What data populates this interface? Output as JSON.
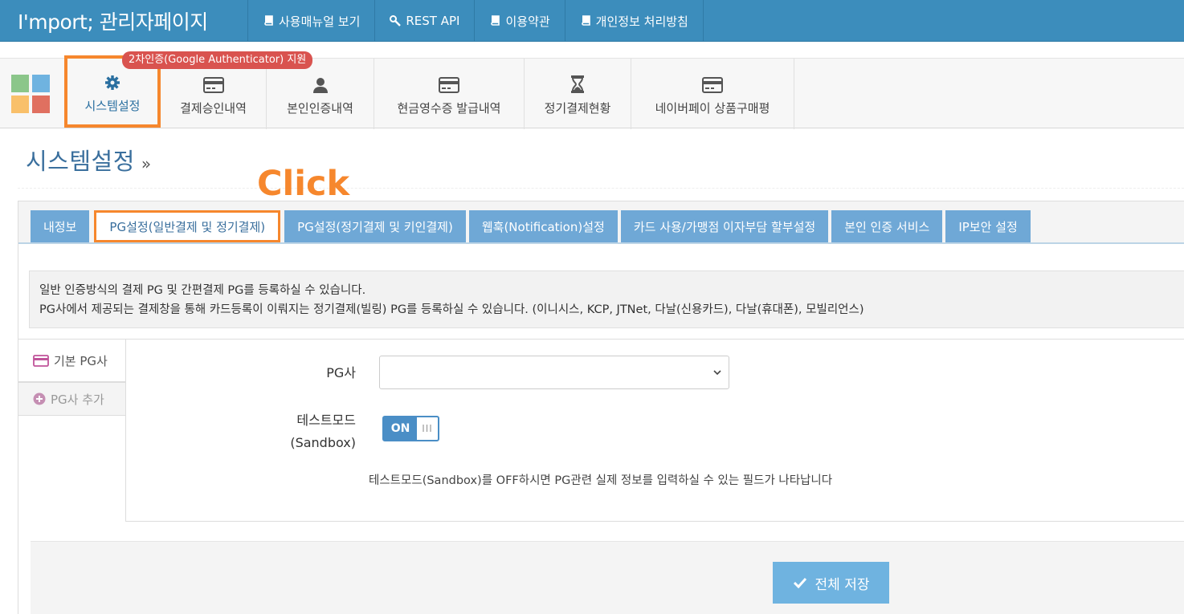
{
  "app": {
    "title": "I'mport; 관리자페이지"
  },
  "topnav": [
    {
      "label": "사용매뉴얼 보기",
      "icon": "book-icon"
    },
    {
      "label": "REST API",
      "icon": "wrench-icon"
    },
    {
      "label": "이용약관",
      "icon": "book-icon"
    },
    {
      "label": "개인정보 처리방침",
      "icon": "book-icon"
    }
  ],
  "menu": {
    "badge": "2차인증(Google Authenticator) 지원",
    "items": [
      {
        "label": "시스템설정",
        "icon": "gear-icon",
        "active": true
      },
      {
        "label": "결제승인내역",
        "icon": "credit-card-icon"
      },
      {
        "label": "본인인증내역",
        "icon": "user-icon"
      },
      {
        "label": "현금영수증 발급내역",
        "icon": "credit-card-icon"
      },
      {
        "label": "정기결제현황",
        "icon": "hourglass-icon"
      },
      {
        "label": "네이버페이 상품구매평",
        "icon": "credit-card-icon"
      }
    ]
  },
  "page": {
    "title": "시스템설정",
    "title_suffix": "»"
  },
  "annotation": {
    "click_label": "Click",
    "color": "#f6872d"
  },
  "tabs": [
    {
      "label": "내정보"
    },
    {
      "label": "PG설정(일반결제 및 정기결제)",
      "active": true
    },
    {
      "label": "PG설정(정기결제 및 키인결제)"
    },
    {
      "label": "웹훅(Notification)설정"
    },
    {
      "label": "카드 사용/가맹점 이자부담 할부설정"
    },
    {
      "label": "본인 인증 서비스"
    },
    {
      "label": "IP보안 설정"
    }
  ],
  "info": {
    "line1": "일반 인증방식의 결제 PG 및 간편결제 PG를 등록하실 수 있습니다.",
    "line2": "PG사에서 제공되는 결제창을 통해 카드등록이 이뤄지는 정기결제(빌링) PG를 등록하실 수 있습니다. (이니시스, KCP, JTNet, 다날(신용카드), 다날(휴대폰), 모빌리언스)"
  },
  "sidetabs": {
    "default_pg": "기본 PG사",
    "add_pg": "PG사 추가"
  },
  "form": {
    "pg_label": "PG사",
    "pg_value": "",
    "testmode_label_1": "테스트모드",
    "testmode_label_2": "(Sandbox)",
    "toggle_on": "ON",
    "toggle_knob": "III",
    "hint": "테스트모드(Sandbox)를 OFF하시면 PG관련 실제 정보를 입력하실 수 있는 필드가 나타납니다"
  },
  "footer": {
    "save_label": "전체 저장"
  },
  "colors": {
    "primary": "#3c8dbc",
    "tab": "#6fa8d6",
    "highlight": "#f6872d",
    "badge": "#d9534f",
    "save": "#6fb3e0"
  }
}
